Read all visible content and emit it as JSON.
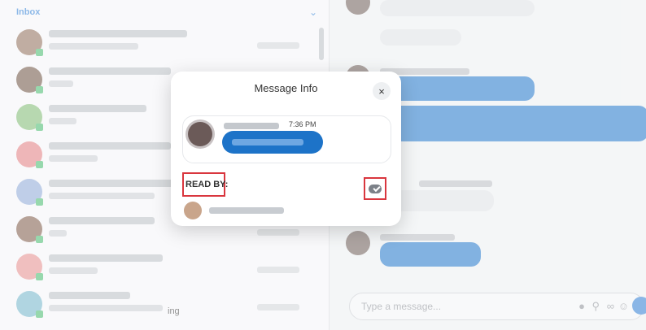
{
  "sidebar": {
    "header": {
      "label": "Inbox",
      "toggle_icon": "chevron-down-icon"
    },
    "typing_fragment": "ing"
  },
  "composer": {
    "placeholder": "Type a message...",
    "icons": [
      "mic-icon",
      "location-icon",
      "attachment-icon",
      "emoji-icon",
      "send-icon"
    ]
  },
  "modal": {
    "title": "Message Info",
    "close_label": "×",
    "message": {
      "time": "7:36 PM"
    },
    "read_by_label": "READ BY:",
    "read_icon": "double-check-icon"
  },
  "colors": {
    "accent": "#1d73c8",
    "status_online": "#43b86b",
    "highlight_border": "#d9363e"
  }
}
